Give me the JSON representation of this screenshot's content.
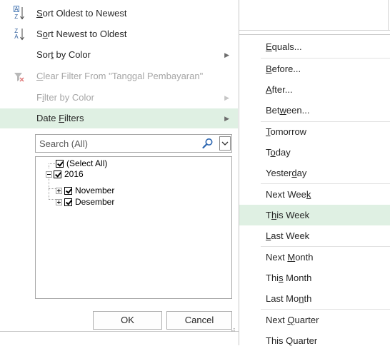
{
  "menu": {
    "sort_oldest": {
      "pre": "",
      "key": "S",
      "post": "ort Oldest to Newest"
    },
    "sort_newest": {
      "pre": "S",
      "key": "o",
      "post": "rt Newest to Oldest"
    },
    "sort_color": {
      "pre": "Sor",
      "key": "t",
      "post": " by Color"
    },
    "clear_filter": {
      "pre": "",
      "key": "C",
      "post": "lear Filter From \"Tanggal Pembayaran\""
    },
    "filter_color": {
      "pre": "F",
      "key": "i",
      "post": "lter by Color"
    },
    "date_filters": {
      "pre": "Date ",
      "key": "F",
      "post": "ilters"
    }
  },
  "search": {
    "placeholder": "Search (All)"
  },
  "tree": {
    "select_all": "(Select All)",
    "year": "2016",
    "month_1": "November",
    "month_2": "Desember"
  },
  "buttons": {
    "ok": "OK",
    "cancel": "Cancel"
  },
  "submenu": {
    "equals": {
      "pre": "",
      "key": "E",
      "post": "quals..."
    },
    "before": {
      "pre": "",
      "key": "B",
      "post": "efore..."
    },
    "after": {
      "pre": "",
      "key": "A",
      "post": "fter..."
    },
    "between": {
      "pre": "Bet",
      "key": "w",
      "post": "een..."
    },
    "tomorrow": {
      "pre": "",
      "key": "T",
      "post": "omorrow"
    },
    "today": {
      "pre": "T",
      "key": "o",
      "post": "day"
    },
    "yesterday": {
      "pre": "Yester",
      "key": "d",
      "post": "ay"
    },
    "next_week": {
      "pre": "Next Wee",
      "key": "k",
      "post": ""
    },
    "this_week": {
      "pre": "T",
      "key": "h",
      "post": "is Week"
    },
    "last_week": {
      "pre": "",
      "key": "L",
      "post": "ast Week"
    },
    "next_month": {
      "pre": "Next ",
      "key": "M",
      "post": "onth"
    },
    "this_month": {
      "pre": "Thi",
      "key": "s",
      "post": " Month"
    },
    "last_month": {
      "pre": "Last Mo",
      "key": "n",
      "post": "th"
    },
    "next_quarter": {
      "pre": "Next ",
      "key": "Q",
      "post": "uarter"
    },
    "this_quarter": {
      "pre": "This Quarter",
      "key": "",
      "post": ""
    }
  },
  "colors": {
    "highlight": "#dff0e3",
    "border": "#c6c6c6",
    "disabled_text": "#a6a6a6"
  },
  "icons": {
    "sort_oldest": "sort-ascending-icon",
    "sort_newest": "sort-descending-icon",
    "clear_filter": "clear-filter-icon",
    "search": "search-icon"
  }
}
